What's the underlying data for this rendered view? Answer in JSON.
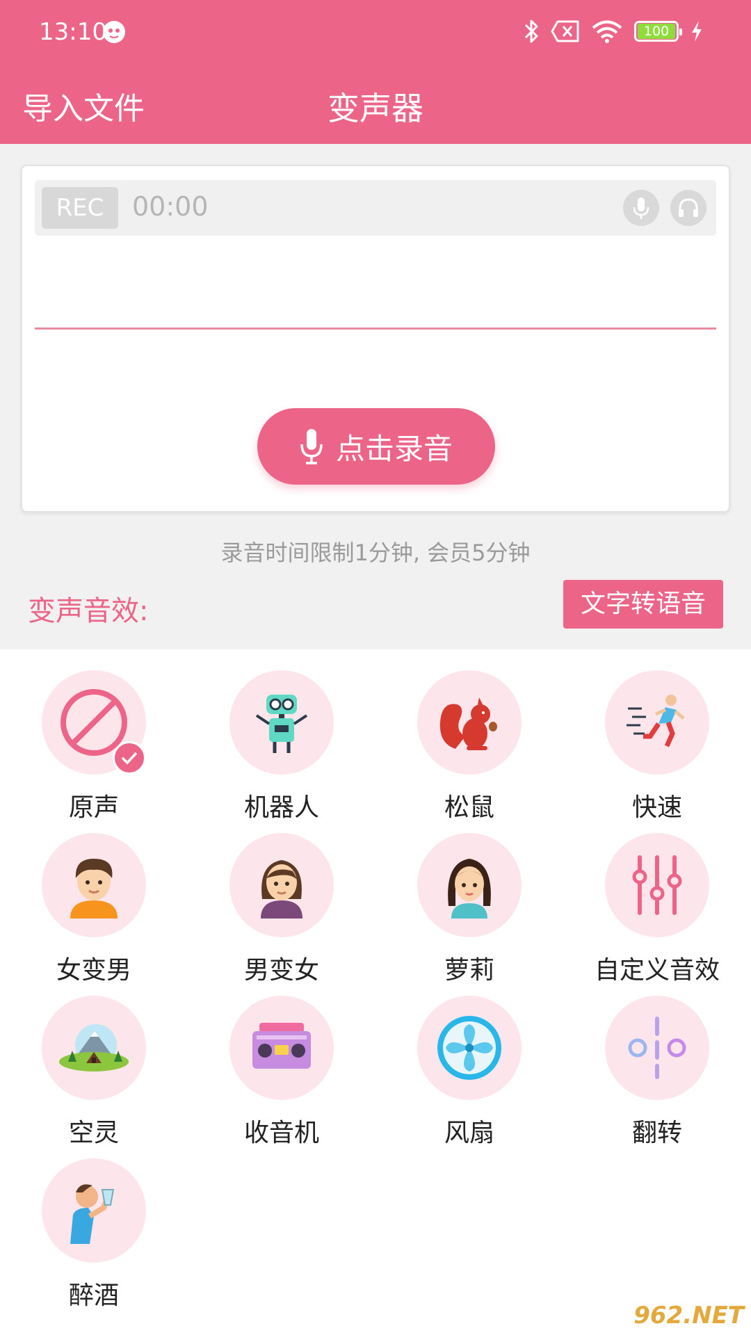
{
  "status_bar": {
    "time": "13:10",
    "battery": "100",
    "icons": [
      "bluetooth-icon",
      "no-sim-icon",
      "wifi-icon",
      "battery-icon",
      "charging-icon"
    ]
  },
  "app_bar": {
    "import_label": "导入文件",
    "title": "变声器"
  },
  "recorder": {
    "rec_badge": "REC",
    "time": "00:00",
    "record_button": "点击录音"
  },
  "hint": "录音时间限制1分钟, 会员5分钟",
  "effects_header": {
    "label": "变声音效:",
    "tts_button": "文字转语音"
  },
  "effects": [
    {
      "label": "原声",
      "icon": "original-voice-icon",
      "selected": true
    },
    {
      "label": "机器人",
      "icon": "robot-icon"
    },
    {
      "label": "松鼠",
      "icon": "squirrel-icon"
    },
    {
      "label": "快速",
      "icon": "fast-runner-icon"
    },
    {
      "label": "女变男",
      "icon": "male-face-icon"
    },
    {
      "label": "男变女",
      "icon": "female-face-icon"
    },
    {
      "label": "萝莉",
      "icon": "girl-face-icon"
    },
    {
      "label": "自定义音效",
      "icon": "equalizer-icon"
    },
    {
      "label": "空灵",
      "icon": "mountain-cabin-icon"
    },
    {
      "label": "收音机",
      "icon": "radio-icon"
    },
    {
      "label": "风扇",
      "icon": "fan-icon"
    },
    {
      "label": "翻转",
      "icon": "flip-icon"
    },
    {
      "label": "醉酒",
      "icon": "drinking-man-icon"
    }
  ],
  "watermark": "962.NET",
  "colors": {
    "primary": "#ec6488",
    "effect_bg": "#fde5ec",
    "page_bg": "#f1f1f1"
  }
}
